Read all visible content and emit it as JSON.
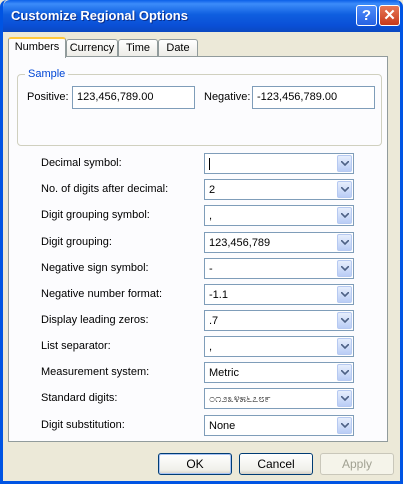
{
  "window": {
    "title": "Customize Regional Options"
  },
  "tabs": [
    {
      "label": "Numbers",
      "active": true
    },
    {
      "label": "Currency",
      "active": false
    },
    {
      "label": "Time",
      "active": false
    },
    {
      "label": "Date",
      "active": false
    }
  ],
  "sample": {
    "group_label": "Sample",
    "positive_label": "Positive:",
    "positive_value": "123,456,789.00",
    "negative_label": "Negative:",
    "negative_value": "-123,456,789.00"
  },
  "settings": [
    {
      "label": "Decimal symbol:",
      "value": ""
    },
    {
      "label": "No. of digits after decimal:",
      "value": "2"
    },
    {
      "label": "Digit grouping symbol:",
      "value": ","
    },
    {
      "label": "Digit grouping:",
      "value": "123,456,789"
    },
    {
      "label": "Negative sign symbol:",
      "value": "-"
    },
    {
      "label": "Negative number format:",
      "value": "-1.1"
    },
    {
      "label": "Display leading zeros:",
      "value": ".7"
    },
    {
      "label": "List separator:",
      "value": ","
    },
    {
      "label": "Measurement system:",
      "value": "Metric"
    },
    {
      "label": "Standard digits:",
      "value": "೦೧೨೩೪೫೬೭೮೯"
    },
    {
      "label": "Digit substitution:",
      "value": "None"
    }
  ],
  "buttons": {
    "ok": "OK",
    "cancel": "Cancel",
    "apply": "Apply"
  },
  "titlebar_buttons": {
    "help": "?",
    "close": "✕"
  },
  "colors": {
    "titlebar": "#0A4FD6",
    "face": "#ECE9D8",
    "accent_tab": "#FFC83C",
    "group_label": "#0046D5"
  }
}
